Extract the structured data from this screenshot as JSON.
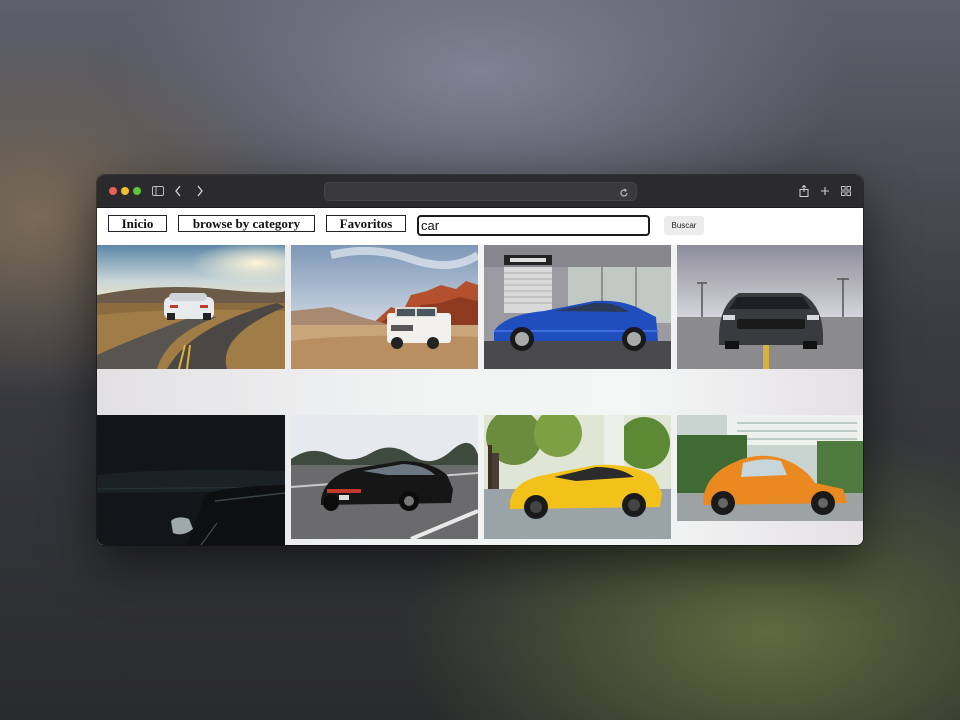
{
  "browser": {
    "url": "",
    "icons": [
      "sidebar-icon",
      "back-icon",
      "forward-icon",
      "reload-icon",
      "share-icon",
      "new-tab-icon",
      "tab-overview-icon"
    ]
  },
  "nav": {
    "home_label": "Inicio",
    "category_label": "browse by category",
    "favorites_label": "Favoritos"
  },
  "search": {
    "value": "car",
    "button_label": "Buscar"
  },
  "gallery": {
    "images": [
      "white sports car on winding road at sunset",
      "white SUV in desert with red rocks",
      "blue coupe in front of garage with entrance sign",
      "dark grey muscle car front view",
      "dark close-up of car side mirror",
      "black sports sedan driving on highway",
      "yellow supercar in front of trees",
      "orange classic beetle on street"
    ]
  },
  "colors": {
    "titlebar": "#2b2a2c",
    "close": "#ec5f57",
    "minimize": "#f1bf2f",
    "maximize": "#5fc53d"
  }
}
